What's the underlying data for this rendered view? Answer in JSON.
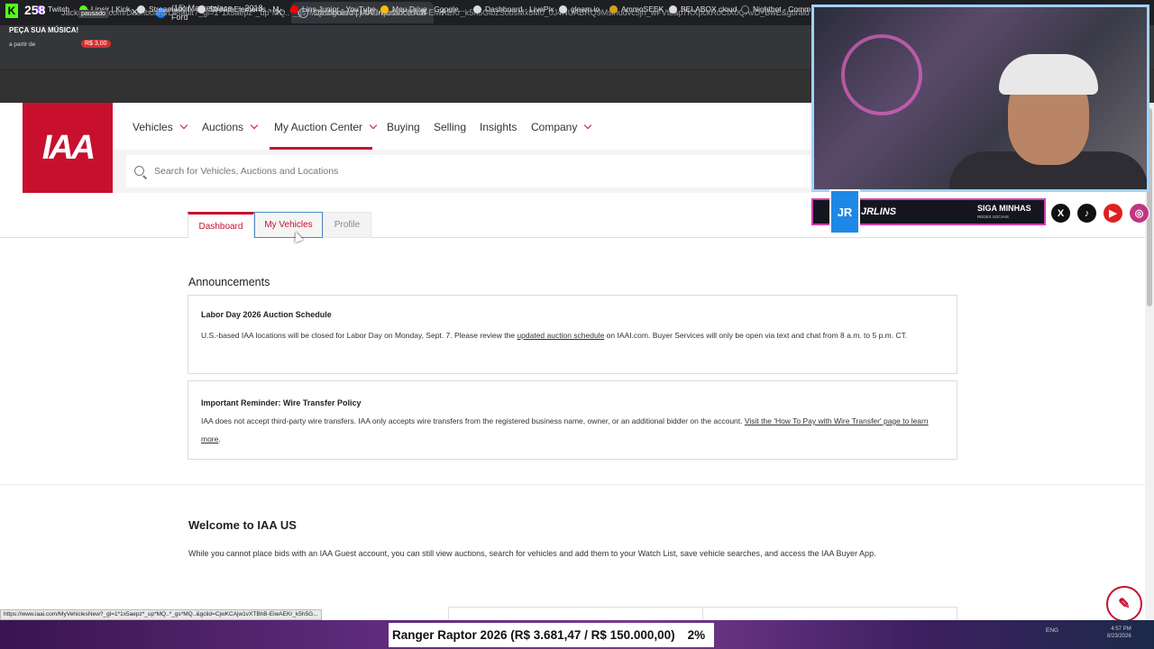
{
  "browser": {
    "tabs": [
      {
        "label": "Jacks Rhyno"
      },
      {
        "label": "(15) Marketplace — 2018 Ford"
      },
      {
        "label": "Dashboard | IAA-Insurance Aut"
      }
    ],
    "url": "iaai.com/Dashboard/Default?_gl=1*1x5aepz*_up*MQ..*_gs*MQ..&gclid=CjwKCAjw1vXTBhB-EiwAEKr_k5h5GlbzSobsMx8M0_0J4NUABRQ9Mslhudvc5jh_wFVteap7KXpckRoCiX0QAvD_BwE&gbraid",
    "bookmarks": [
      "Twitch",
      "Linsjr | Kick",
      "StreamerKit",
      "StreamElements - M...",
      "Lins Junior - YouTube",
      "Meu Drive - Google...",
      "Dashboard - LivePix",
      "gleam.io",
      "AmmoSEEK",
      "BELABOX cloud",
      "Nightbot - Comm"
    ]
  },
  "kick_overlay": {
    "viewers": "258",
    "paused": "pausado",
    "music": "PEÇA SUA MÚSICA!",
    "from": "a partir de",
    "price": "R$ 3,00"
  },
  "site": {
    "logo": "IAA",
    "nav": [
      {
        "label": "Vehicles",
        "dropdown": true
      },
      {
        "label": "Auctions",
        "dropdown": true
      },
      {
        "label": "My Auction Center",
        "dropdown": true
      },
      {
        "label": "Buying",
        "dropdown": false
      },
      {
        "label": "Selling",
        "dropdown": false
      },
      {
        "label": "Insights",
        "dropdown": false
      },
      {
        "label": "Company",
        "dropdown": true
      }
    ],
    "search_placeholder": "Search for Vehicles, Auctions and Locations",
    "accent": "#c8102e"
  },
  "subtabs": [
    "Dashboard",
    "My Vehicles",
    "Profile"
  ],
  "announcements": {
    "title": "Announcements",
    "items": [
      {
        "heading": "Labor Day 2026 Auction Schedule",
        "text_before": "U.S.-based IAA locations will be closed for Labor Day on Monday, Sept. 7. Please review the ",
        "link": "updated auction schedule",
        "text_after": " on IAAI.com. Buyer Services will only be open via text and chat from 8 a.m. to 5 p.m. CT."
      },
      {
        "heading": "Important Reminder: Wire Transfer Policy",
        "text_before": "IAA does not accept third-party wire transfers. IAA only accepts wire transfers from the registered business name, owner, or an additional bidder on the account. ",
        "link": "Visit the 'How To Pay with Wire Transfer' page to learn more",
        "text_after": "."
      }
    ]
  },
  "welcome": {
    "title": "Welcome to IAA US",
    "text": "While you cannot place bids with an IAA Guest account, you can still view auctions, search for vehicles and add them to your Watch List, save vehicle searches, and access the IAA Buyer App."
  },
  "status_url": "https://www.iaai.com/MyVehiclesNew?_gl=1*1x5aepz*_up*MQ..*_gs*MQ..&gclid=CjwKCAjw1vXTBhB-EiwAEKr_k5h5G...",
  "stream": {
    "goal_text": "Ranger Raptor 2026 (R$ 3.681,47 / R$ 150.000,00)",
    "goal_pct": "2%",
    "tray_lang": "ENG",
    "clock_time": "4:57 PM",
    "clock_date": "8/23/2026"
  },
  "webcam": {
    "name": "JRLINS",
    "follow": "SIGA MINHAS",
    "follow_sub": "REDES SOCIAIS",
    "badge": "JR LINS"
  }
}
